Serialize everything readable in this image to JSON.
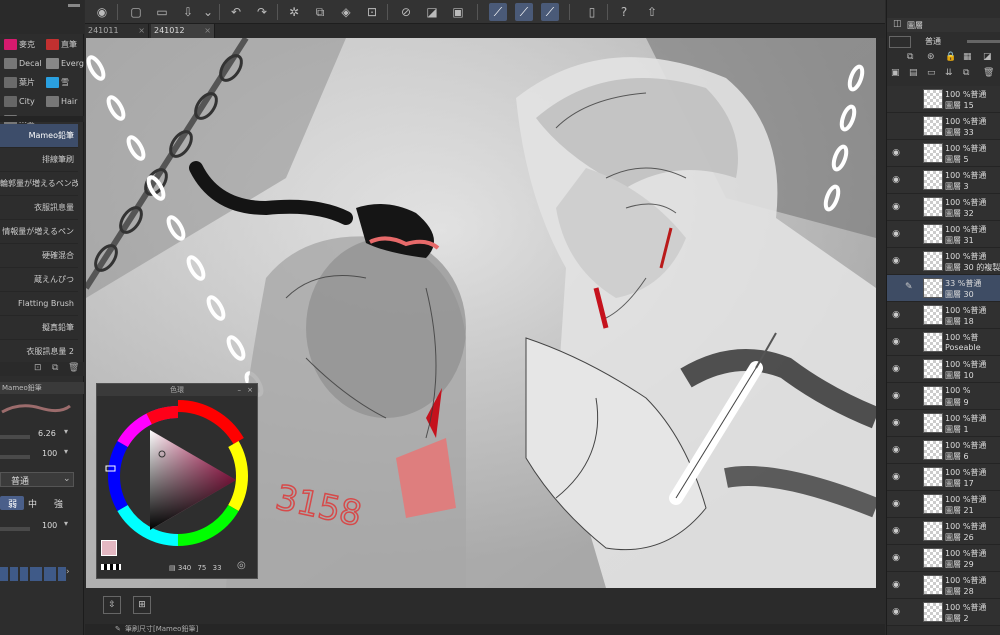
{
  "tabs": [
    {
      "label": "241011",
      "active": false
    },
    {
      "label": "241012",
      "active": true
    }
  ],
  "left_panel": {
    "subtools": [
      {
        "label": "麥克",
        "color": "#d61a6e"
      },
      {
        "label": "直筆",
        "color": "#c23030"
      },
      {
        "label": "Decal",
        "color": "#777"
      },
      {
        "label": "Everg",
        "color": "#888"
      },
      {
        "label": "葉片",
        "color": "#6a6a6a"
      },
      {
        "label": "雪",
        "color": "#2aa0e0"
      },
      {
        "label": "City",
        "color": "#666"
      },
      {
        "label": "Hair",
        "color": "#777"
      },
      {
        "label": "m金",
        "color": "#777"
      }
    ],
    "brushes": [
      {
        "label": "Mameo鉛筆",
        "active": true
      },
      {
        "label": "排線筆刷",
        "active": false
      },
      {
        "label": "輪郭量が増えるペン改_",
        "active": false
      },
      {
        "label": "衣服訊息量",
        "active": false
      },
      {
        "label": "情報量が増えるペン",
        "active": false
      },
      {
        "label": "硬確混合",
        "active": false
      },
      {
        "label": "蔵えんぴつ",
        "active": false
      },
      {
        "label": "Flatting Brush",
        "active": false
      },
      {
        "label": "擬真鉛筆",
        "active": false
      },
      {
        "label": "衣服訊息量 2",
        "active": false
      }
    ],
    "props_title": "Mameo鉛筆",
    "brush_size": "6.26",
    "opacity": "100",
    "blend_mode": "普通",
    "ink_options": [
      "弱",
      "中",
      "強"
    ],
    "density": "100"
  },
  "color_panel": {
    "title": "色環",
    "h": "340",
    "s": "75",
    "v": "33",
    "main_color": "#e4b8c2",
    "sub_color": "#7a2a50"
  },
  "canvas_text": "3158",
  "layer_panel": {
    "title": "圖層",
    "blend_mode": "普通",
    "layers": [
      {
        "pct": "100 %普通",
        "name": "圖層 15",
        "eye": false,
        "sel": false
      },
      {
        "pct": "100 %普通",
        "name": "圖層 33",
        "eye": false,
        "sel": false
      },
      {
        "pct": "100 %普通",
        "name": "圖層 5",
        "eye": true,
        "sel": false
      },
      {
        "pct": "100 %普通",
        "name": "圖層 3",
        "eye": true,
        "sel": false
      },
      {
        "pct": "100 %普通",
        "name": "圖層 32",
        "eye": true,
        "sel": false
      },
      {
        "pct": "100 %普通",
        "name": "圖層 31",
        "eye": true,
        "sel": false
      },
      {
        "pct": "100 %普通",
        "name": "圖層 30 的複製",
        "eye": true,
        "sel": false
      },
      {
        "pct": "33 %普通",
        "name": "圖層 30",
        "eye": false,
        "sel": true
      },
      {
        "pct": "100 %普通",
        "name": "圖層 18",
        "eye": true,
        "sel": false
      },
      {
        "pct": "100 %普",
        "name": "Poseable",
        "eye": true,
        "sel": false
      },
      {
        "pct": "100 %普通",
        "name": "圖層 10",
        "eye": true,
        "sel": false
      },
      {
        "pct": "100 %",
        "name": "圖層 9",
        "eye": true,
        "sel": false
      },
      {
        "pct": "100 %普通",
        "name": "圖層 1",
        "eye": true,
        "sel": false
      },
      {
        "pct": "100 %普通",
        "name": "圖層 6",
        "eye": true,
        "sel": false
      },
      {
        "pct": "100 %普通",
        "name": "圖層 17",
        "eye": true,
        "sel": false
      },
      {
        "pct": "100 %普通",
        "name": "圖層 21",
        "eye": true,
        "sel": false
      },
      {
        "pct": "100 %普通",
        "name": "圖層 26",
        "eye": true,
        "sel": false
      },
      {
        "pct": "100 %普通",
        "name": "圖層 29",
        "eye": true,
        "sel": false
      },
      {
        "pct": "100 %普通",
        "name": "圖層 28",
        "eye": true,
        "sel": false
      },
      {
        "pct": "100 %普通",
        "name": "圖層 2",
        "eye": true,
        "sel": false
      }
    ]
  },
  "status": {
    "text": "筆刷尺寸[Mameo鉛筆]"
  }
}
